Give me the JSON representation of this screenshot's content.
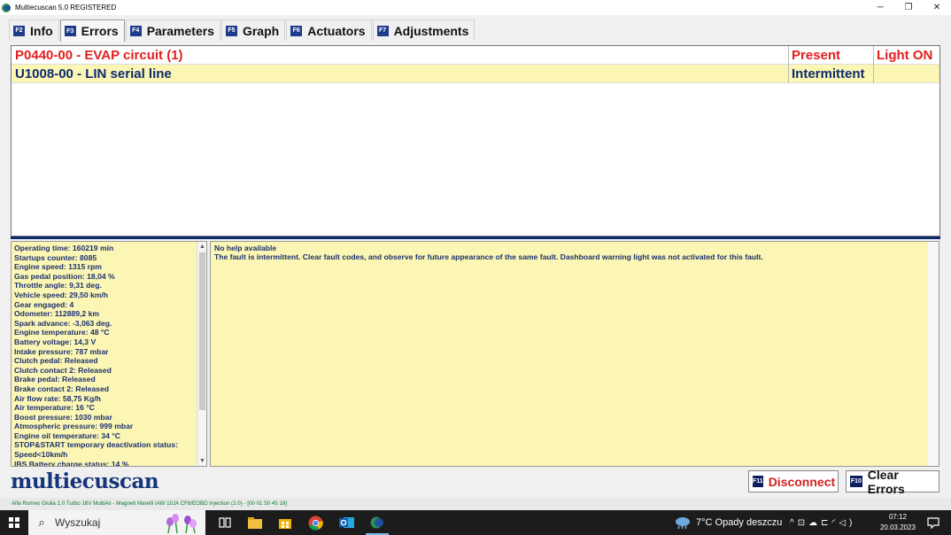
{
  "window": {
    "title": "Multiecuscan 5.0 REGISTERED",
    "buttons": [
      "─",
      "❐",
      "✕"
    ]
  },
  "tabs": [
    {
      "key": "F2",
      "label": "Info"
    },
    {
      "key": "F3",
      "label": "Errors",
      "active": true
    },
    {
      "key": "F4",
      "label": "Parameters"
    },
    {
      "key": "F5",
      "label": "Graph"
    },
    {
      "key": "F6",
      "label": "Actuators"
    },
    {
      "key": "F7",
      "label": "Adjustments"
    }
  ],
  "errors": [
    {
      "code": "P0440-00 - EVAP circuit (1)",
      "state": "Present",
      "light": "Light ON"
    },
    {
      "code": "U1008-00 - LIN serial line",
      "state": "Intermittent",
      "light": ""
    }
  ],
  "parameters": [
    "Operating time: 160219 min",
    "Startups counter: 8085",
    "Engine speed: 1315 rpm",
    "Gas pedal position: 18,04 %",
    "Throttle angle: 9,31 deg.",
    "Vehicle speed: 29,50 km/h",
    "Gear engaged: 4",
    "Odometer: 112889,2 km",
    "Spark advance: -3,063 deg.",
    "Engine temperature: 48 °C",
    "Battery voltage: 14,3 V",
    "Intake pressure: 787 mbar",
    "Clutch pedal: Released",
    "Clutch contact 2: Released",
    "Brake pedal: Released",
    "Brake contact 2: Released",
    "Air flow rate: 58,75 Kg/h",
    "Air temperature: 16 °C",
    "Boost pressure: 1030 mbar",
    "Atmospheric pressure: 999 mbar",
    "Engine oil temperature: 34 °C",
    "STOP&START temporary deactivation status:",
    "Speed<10km/h",
    "IBS Battery charge status: 14 %"
  ],
  "help": {
    "title": "No help available",
    "text": "The fault is intermittent. Clear fault codes, and observe for future appearance of the same fault. Dashboard warning light was not activated for this fault."
  },
  "logo": "multiecuscan",
  "buttons": {
    "disconnect": {
      "key": "F11",
      "label": "Disconnect"
    },
    "clear": {
      "key": "F10",
      "label": "Clear Errors"
    }
  },
  "status_line": "Alfa Romeo Giulia 2.0 Turbo 16V MultiAir - Magneti Marelli IAW 10JA CF6/EOBD Injection (2.0) - [00 01 50 45 18]",
  "taskbar": {
    "search_placeholder": "Wyszukaj",
    "weather": "7°C  Opady deszczu",
    "time": "07:12",
    "date": "20.03.2023"
  },
  "colors": {
    "accent": "#1e3c8c",
    "error_red": "#e0201e",
    "help_bg": "#fcf6b4",
    "text_navy": "#1a3070",
    "status_green": "#0c7a2c"
  }
}
